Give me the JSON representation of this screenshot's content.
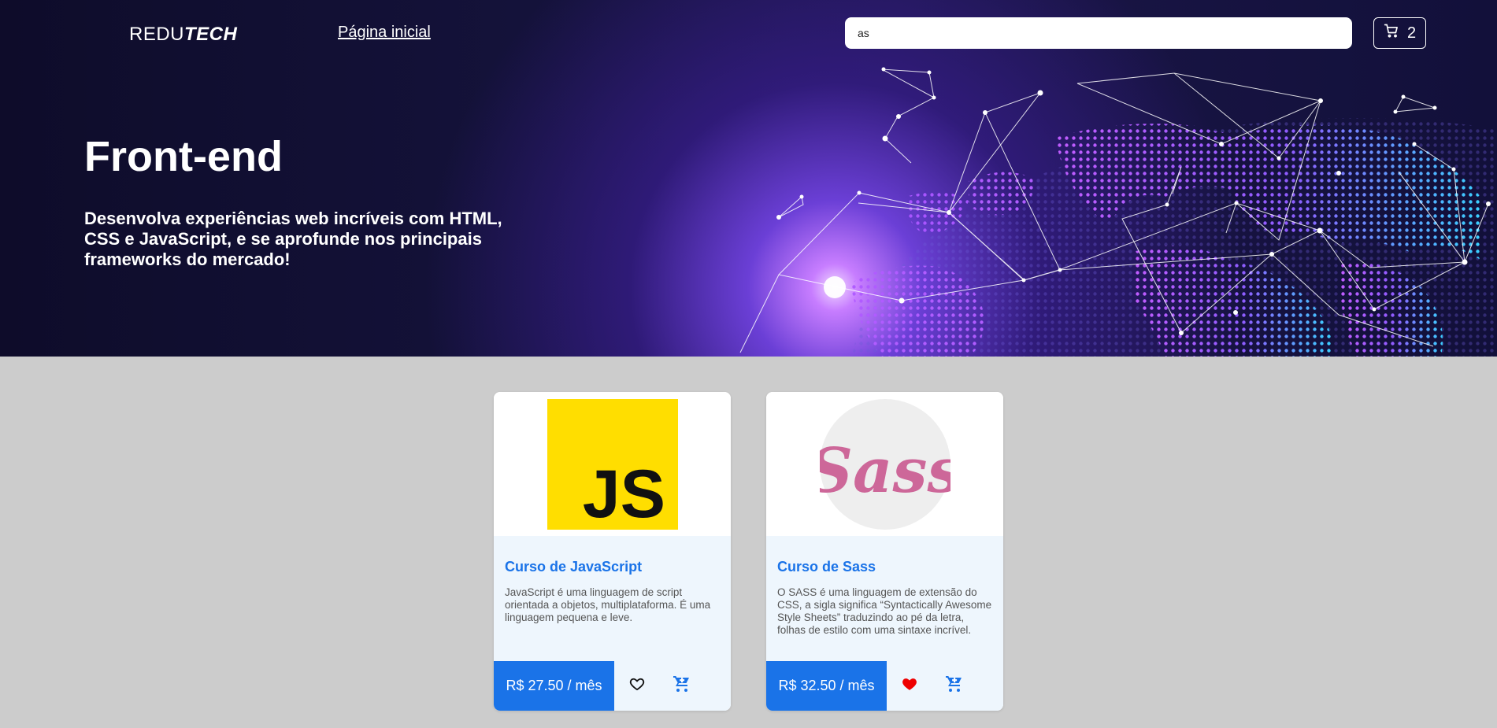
{
  "header": {
    "logo_part1": "REDU",
    "logo_part2": "TECH",
    "nav_home": "Página inicial",
    "search_value": "as",
    "cart_count": "2"
  },
  "hero": {
    "title": "Front-end",
    "subtitle": "Desenvolva experiências web incríveis com HTML, CSS e JavaScript, e se aprofunde nos principais frameworks do mercado!"
  },
  "courses": [
    {
      "logo_text": "JS",
      "title": "Curso de JavaScript",
      "description": "JavaScript é uma linguagem de script orientada a objetos, multiplataforma. É uma linguagem pequena e leve.",
      "price": "R$ 27.50 / mês",
      "favorited": false
    },
    {
      "logo_text": "Sass",
      "title": "Curso de Sass",
      "description": "O SASS é uma linguagem de extensão do CSS, a sigla significa “Syntactically Awesome Style Sheets” traduzindo ao pé da letra, folhas de estilo com uma sintaxe incrível.",
      "price": "R$ 32.50 / mês",
      "favorited": true
    }
  ],
  "colors": {
    "accent": "#1a73e8",
    "js_yellow": "#ffde00",
    "sass_pink": "#cd6799",
    "heart_red": "#ee0000"
  },
  "icons": {
    "cart": "cart-icon",
    "heart": "heart-icon",
    "add_to_cart": "add-to-cart-icon"
  }
}
